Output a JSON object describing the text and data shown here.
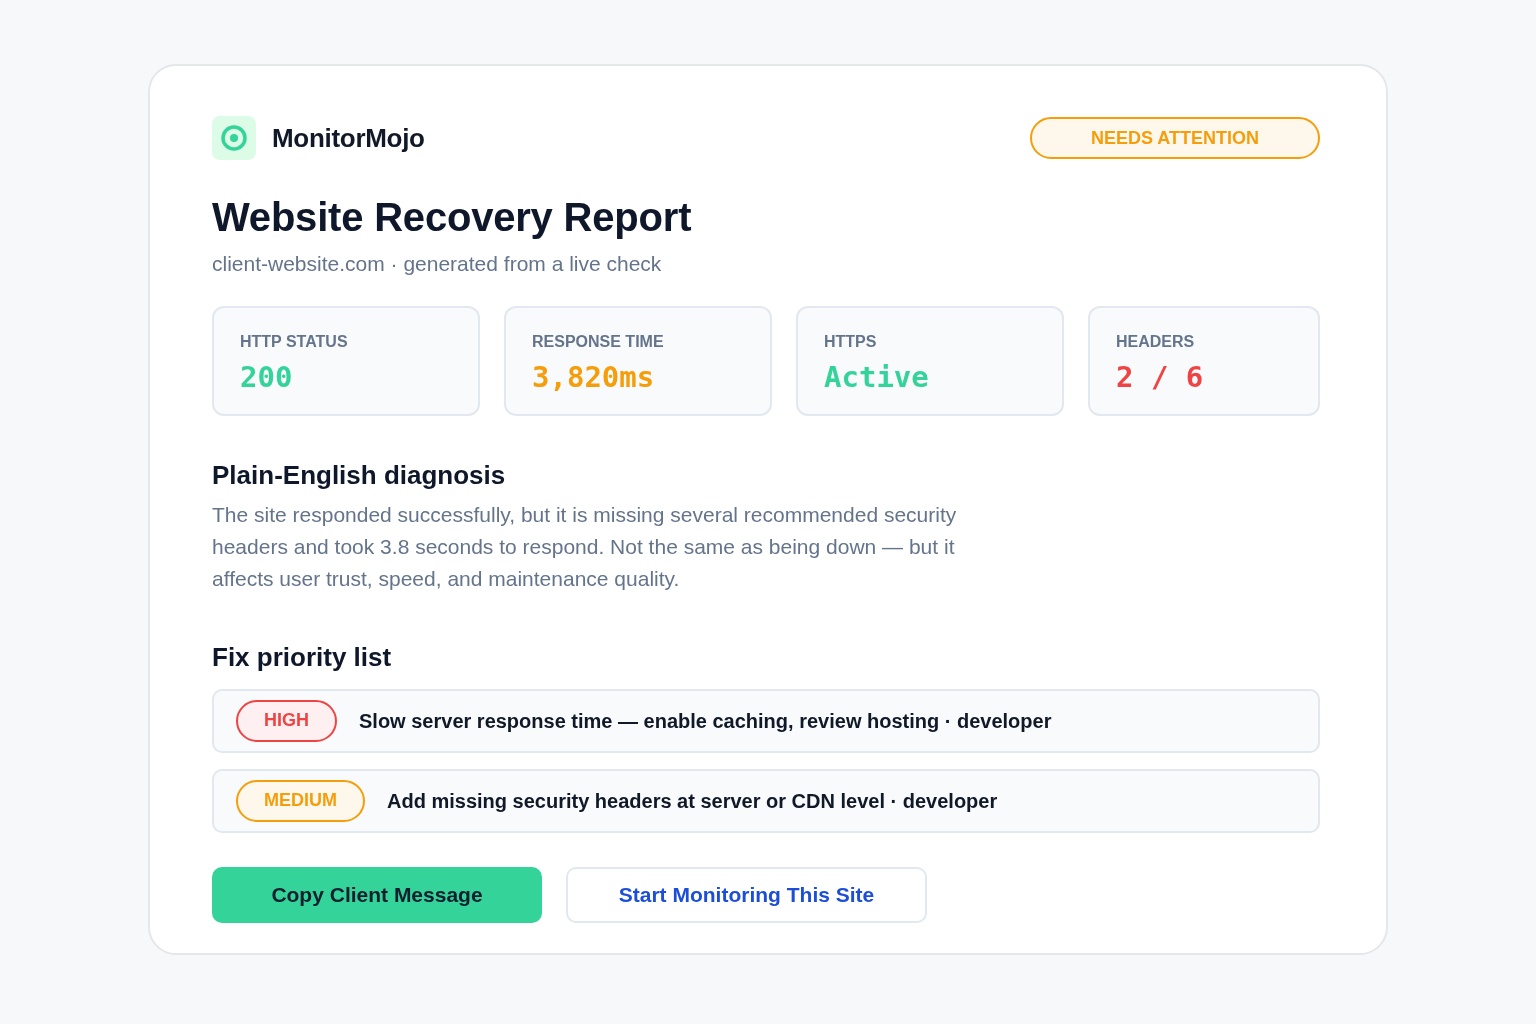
{
  "brand": {
    "name": "MonitorMojo"
  },
  "status": {
    "label": "NEEDS ATTENTION",
    "color": "#f59e0b"
  },
  "report": {
    "title": "Website Recovery Report",
    "subtitle": "client-website.com · generated from a live check"
  },
  "metrics": [
    {
      "label": "HTTP STATUS",
      "value": "200",
      "color": "#34d399"
    },
    {
      "label": "RESPONSE TIME",
      "value": "3,820ms",
      "color": "#f59e0b"
    },
    {
      "label": "HTTPS",
      "value": "Active",
      "color": "#34d399"
    },
    {
      "label": "HEADERS",
      "value": "2 / 6",
      "color": "#ef4444"
    }
  ],
  "diagnosis": {
    "heading": "Plain-English diagnosis",
    "text": "The site responded successfully, but it is missing several recommended security headers and took 3.8 seconds to respond. Not the same as being down — but it affects user trust, speed, and maintenance quality."
  },
  "priorities": {
    "heading": "Fix priority list",
    "items": [
      {
        "badge": "HIGH",
        "color": "#ef4444",
        "text": "Slow server response time — enable caching, review hosting · developer"
      },
      {
        "badge": "MEDIUM",
        "color": "#f59e0b",
        "text": "Add missing security headers at server or CDN level · developer"
      }
    ]
  },
  "actions": [
    {
      "label": "Copy Client Message",
      "kind": "primary"
    },
    {
      "label": "Start Monitoring This Site",
      "kind": "outline"
    }
  ]
}
